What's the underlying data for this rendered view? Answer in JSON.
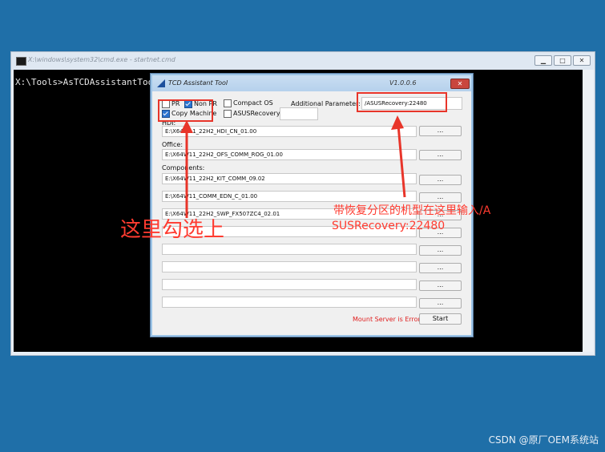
{
  "cmd": {
    "title": "X:\\windows\\system32\\cmd.exe - startnet.cmd",
    "prompt_line": "X:\\Tools>AsTCDAssistantTool.e",
    "minimize": "▁",
    "maximize": "□",
    "close": "✕"
  },
  "dialog": {
    "title": "TCD Assistant Tool",
    "version": "V1.0.0.6",
    "close": "✕",
    "checkboxes": {
      "pr": {
        "label": "PR",
        "checked": false
      },
      "non_pr": {
        "label": "Non PR",
        "checked": true
      },
      "copy_machine": {
        "label": "Copy Machine",
        "checked": true
      },
      "compact_os": {
        "label": "Compact OS",
        "checked": false
      },
      "asus_recovery": {
        "label": "ASUSRecovery:",
        "checked": false
      }
    },
    "additional_parameter_label": "Additional Parameter:",
    "additional_parameter_value": "/ASUSRecovery:22480",
    "hdi_label": "HDI:",
    "hdi_value": "E:\\X64W11_22H2_HDI_CN_01.00",
    "office_label": "Office:",
    "office_value": "E:\\X64W11_22H2_OFS_COMM_ROG_01.00",
    "components_label": "Components:",
    "components": [
      "E:\\X64W11_22H2_KIT_COMM_09.02",
      "E:\\X64W11_COMM_EDN_C_01.00",
      "E:\\X64W11_22H2_SWP_FX507ZC4_02.01",
      "",
      "",
      "",
      "",
      ""
    ],
    "browse_label": "...",
    "status_text": "Mount Server is Error!",
    "start_label": "Start"
  },
  "annotations": {
    "left_note": "这里勾选上",
    "right_note_line1": "带恢复分区的机型在这里输入/A",
    "right_note_line2": "SUSRecovery:22480",
    "color": "#e8352a"
  },
  "watermark": "CSDN @原厂OEM系统站"
}
